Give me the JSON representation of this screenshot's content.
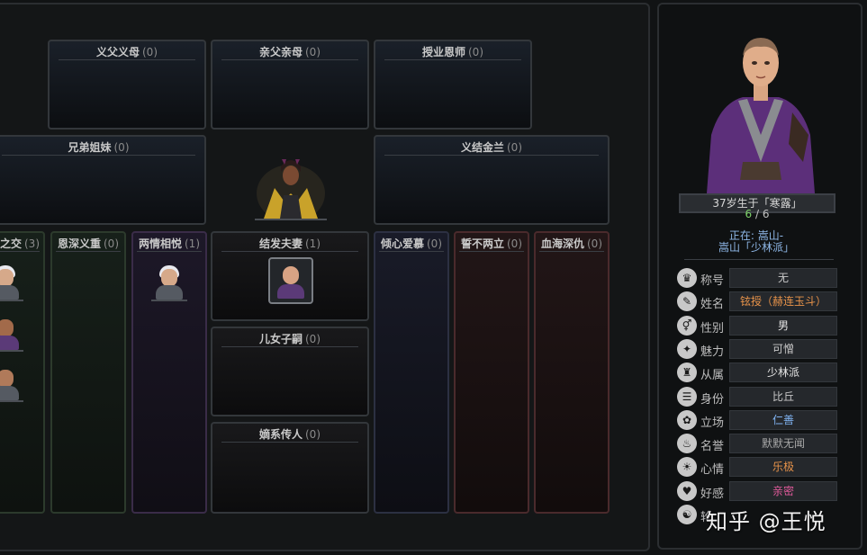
{
  "relations": {
    "adoptive_parents": {
      "title": "义父义母",
      "count": "(0)"
    },
    "parents": {
      "title": "亲父亲母",
      "count": "(0)"
    },
    "mentors": {
      "title": "授业恩师",
      "count": "(0)"
    },
    "siblings": {
      "title": "兄弟姐妹",
      "count": "(0)"
    },
    "sworn": {
      "title": "义结金兰",
      "count": "(0)"
    },
    "friends": {
      "title": "之交",
      "count": "(3)"
    },
    "benefactors": {
      "title": "恩深义重",
      "count": "(0)"
    },
    "mutual_love": {
      "title": "两情相悦",
      "count": "(1)"
    },
    "spouse": {
      "title": "结发夫妻",
      "count": "(1)"
    },
    "children": {
      "title": "儿女子嗣",
      "count": "(0)"
    },
    "heirs": {
      "title": "嫡系传人",
      "count": "(0)"
    },
    "admirers": {
      "title": "倾心爱慕",
      "count": "(0)"
    },
    "rivals": {
      "title": "誓不两立",
      "count": "(0)"
    },
    "enemies": {
      "title": "血海深仇",
      "count": "(0)"
    }
  },
  "character": {
    "age_text": "37岁生于「寒露」",
    "hp_current": "6",
    "hp_sep": " / ",
    "hp_max": "6",
    "location_line1": "正在: 嵩山-",
    "location_line2": "嵩山「少林派」",
    "attributes": [
      {
        "icon": "title-icon",
        "glyph": "♛",
        "label": "称号",
        "value": "无",
        "color": "#c9c9c9"
      },
      {
        "icon": "name-icon",
        "glyph": "✎",
        "label": "姓名",
        "value": "铉授（赫连玉斗）",
        "color": "#e8934a"
      },
      {
        "icon": "gender-icon",
        "glyph": "⚥",
        "label": "性别",
        "value": "男",
        "color": "#e6e6e6"
      },
      {
        "icon": "charm-icon",
        "glyph": "✦",
        "label": "魅力",
        "value": "可憎",
        "color": "#c9c9c9"
      },
      {
        "icon": "faction-icon",
        "glyph": "♜",
        "label": "从属",
        "value": "少林派",
        "color": "#e6e6e6"
      },
      {
        "icon": "status-icon",
        "glyph": "☰",
        "label": "身份",
        "value": "比丘",
        "color": "#c9c9c9"
      },
      {
        "icon": "stance-icon",
        "glyph": "✿",
        "label": "立场",
        "value": "仁善",
        "color": "#7fb2f0"
      },
      {
        "icon": "fame-icon",
        "glyph": "♨",
        "label": "名誉",
        "value": "默默无闻",
        "color": "#a8a8a8"
      },
      {
        "icon": "mood-icon",
        "glyph": "☀",
        "label": "心情",
        "value": "乐极",
        "color": "#e8934a"
      },
      {
        "icon": "favor-icon",
        "glyph": "♥",
        "label": "好感",
        "value": "亲密",
        "color": "#e05a9a"
      },
      {
        "icon": "yinyang-icon",
        "glyph": "☯",
        "label": "轮",
        "value": "",
        "color": "#c9c9c9"
      }
    ]
  },
  "watermark": "知乎 @王悦"
}
